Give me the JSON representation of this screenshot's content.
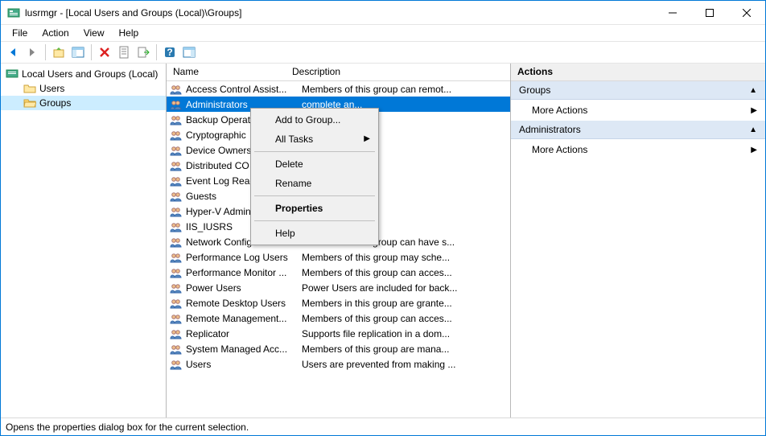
{
  "window": {
    "title": "lusrmgr - [Local Users and Groups (Local)\\Groups]"
  },
  "menubar": [
    "File",
    "Action",
    "View",
    "Help"
  ],
  "tree": {
    "root": "Local Users and Groups (Local)",
    "items": [
      "Users",
      "Groups"
    ],
    "selected": 1
  },
  "columns": {
    "name": "Name",
    "desc": "Description"
  },
  "groups": [
    {
      "name": "Access Control Assist...",
      "desc": "Members of this group can remot...",
      "sel": false
    },
    {
      "name": "Administrators",
      "desc": "complete an...",
      "sel": true
    },
    {
      "name": "Backup Operators",
      "desc": "override se...",
      "sel": false
    },
    {
      "name": "Cryptographic",
      "desc": "ed to perfor...",
      "sel": false
    },
    {
      "name": "Device Owners",
      "desc": "p can chang...",
      "sel": false
    },
    {
      "name": "Distributed CO",
      "desc": "to launch, a...",
      "sel": false
    },
    {
      "name": "Event Log Readers",
      "desc": "p can read e...",
      "sel": false
    },
    {
      "name": "Guests",
      "desc": "access as m...",
      "sel": false
    },
    {
      "name": "Hyper-V Admin",
      "desc": "p have com...",
      "sel": false
    },
    {
      "name": "IIS_IUSRS",
      "desc": "Internet Inf...",
      "sel": false
    },
    {
      "name": "Network Configuratio...",
      "desc": "Members in this group can have s...",
      "sel": false
    },
    {
      "name": "Performance Log Users",
      "desc": "Members of this group may sche...",
      "sel": false
    },
    {
      "name": "Performance Monitor ...",
      "desc": "Members of this group can acces...",
      "sel": false
    },
    {
      "name": "Power Users",
      "desc": "Power Users are included for back...",
      "sel": false
    },
    {
      "name": "Remote Desktop Users",
      "desc": "Members in this group are grante...",
      "sel": false
    },
    {
      "name": "Remote Management...",
      "desc": "Members of this group can acces...",
      "sel": false
    },
    {
      "name": "Replicator",
      "desc": "Supports file replication in a dom...",
      "sel": false
    },
    {
      "name": "System Managed Acc...",
      "desc": "Members of this group are mana...",
      "sel": false
    },
    {
      "name": "Users",
      "desc": "Users are prevented from making ...",
      "sel": false
    }
  ],
  "context_menu": {
    "add_to_group": "Add to Group...",
    "all_tasks": "All Tasks",
    "delete": "Delete",
    "rename": "Rename",
    "properties": "Properties",
    "help": "Help"
  },
  "actions": {
    "header": "Actions",
    "section1": "Groups",
    "more1": "More Actions",
    "section2": "Administrators",
    "more2": "More Actions"
  },
  "statusbar": "Opens the properties dialog box for the current selection."
}
